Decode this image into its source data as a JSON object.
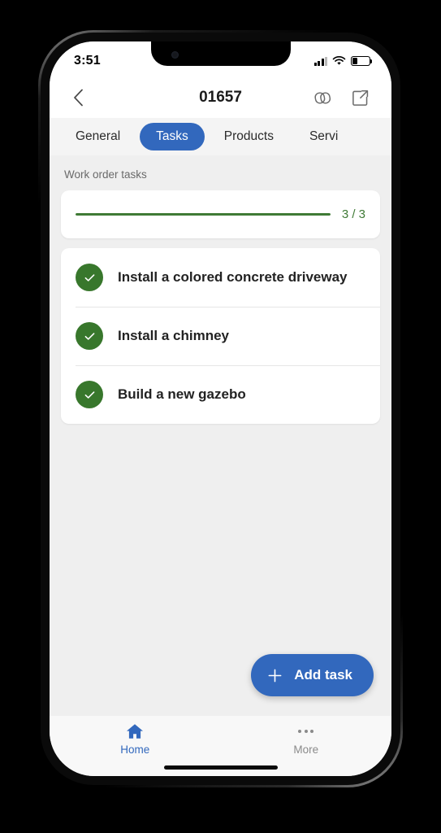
{
  "status_bar": {
    "time": "3:51",
    "signal_icon": "signal-bars-icon",
    "wifi_icon": "wifi-icon",
    "battery_icon": "battery-low-icon",
    "battery_level_pct": 27
  },
  "app_bar": {
    "back_icon": "chevron-left-icon",
    "title": "01657",
    "actions": [
      {
        "name": "related-records-icon",
        "label": "Related"
      },
      {
        "name": "open-in-new-icon",
        "label": "Share"
      }
    ]
  },
  "tabs": {
    "items": [
      {
        "label": "General",
        "active": false
      },
      {
        "label": "Tasks",
        "active": true
      },
      {
        "label": "Products",
        "active": false
      },
      {
        "label": "Servi",
        "active": false
      }
    ]
  },
  "main": {
    "section_label": "Work order tasks",
    "progress": {
      "completed": 3,
      "total": 3,
      "count_text": "3 / 3",
      "percent": 100,
      "color": "#3f7a35"
    },
    "tasks": [
      {
        "title": "Install a colored concrete driveway",
        "completed": true
      },
      {
        "title": "Install a chimney",
        "completed": true
      },
      {
        "title": "Build a new gazebo",
        "completed": true
      }
    ]
  },
  "fab": {
    "label": "Add task",
    "icon": "plus-icon",
    "color": "#3268bd"
  },
  "bottom_nav": {
    "items": [
      {
        "label": "Home",
        "icon": "home-icon",
        "active": true
      },
      {
        "label": "More",
        "icon": "ellipsis-icon",
        "active": false
      }
    ]
  },
  "theme": {
    "accent_blue": "#3268bd",
    "success_green": "#38772c",
    "page_bg": "#efefef"
  }
}
